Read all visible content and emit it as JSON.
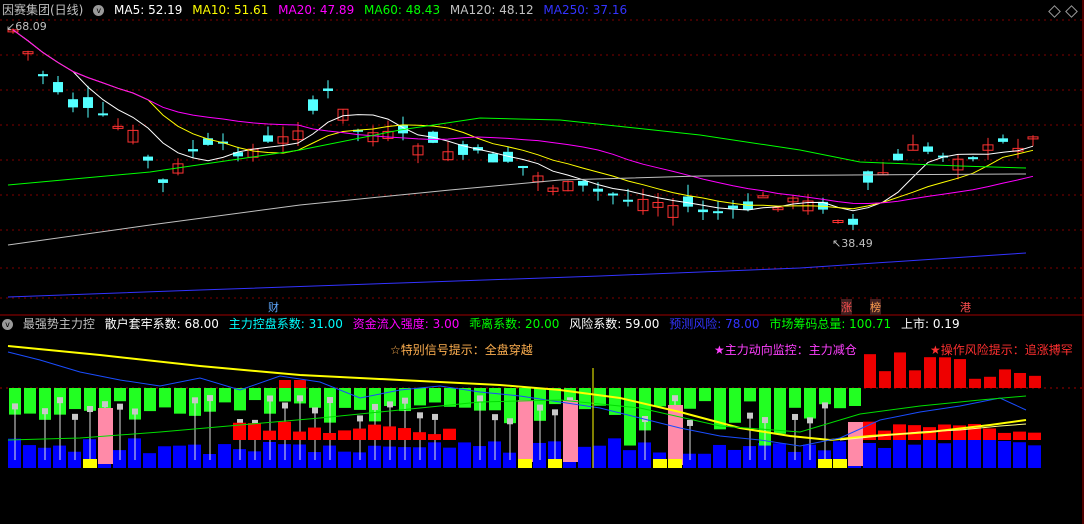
{
  "top_panel": {
    "title": "因赛集团(日线)",
    "ma": [
      {
        "label": "MA5: 52.19",
        "color": "#ffffff"
      },
      {
        "label": "MA10: 51.61",
        "color": "#ffff00"
      },
      {
        "label": "MA20: 47.89",
        "color": "#ff00ff"
      },
      {
        "label": "MA60: 48.43",
        "color": "#00ff00"
      },
      {
        "label": "MA120: 48.12",
        "color": "#c0c0c0"
      },
      {
        "label": "MA250: 37.16",
        "color": "#3333ff"
      }
    ],
    "high_label": "68.09",
    "low_label": "38.49",
    "markers": [
      {
        "text": "财",
        "color": "#5fa8ff"
      },
      {
        "text": "涨",
        "color": "#ff5050"
      },
      {
        "text": "榜",
        "color": "#ffa050"
      },
      {
        "text": "港",
        "color": "#ff5050"
      }
    ]
  },
  "bottom_panel": {
    "title": "最强势主力控",
    "params": [
      {
        "label": "散户套牢系数: 68.00",
        "color": "#ffffff"
      },
      {
        "label": "主力控盘系数: 31.00",
        "color": "#00ffff"
      },
      {
        "label": "资金流入强度: 3.00",
        "color": "#ff00ff"
      },
      {
        "label": "乖离系数: 20.00",
        "color": "#00ff00"
      },
      {
        "label": "风险系数: 59.00",
        "color": "#ffffff"
      },
      {
        "label": "预测风险: 78.00",
        "color": "#3333ff"
      },
      {
        "label": "市场筹码总量: 100.71",
        "color": "#00ff00"
      },
      {
        "label": "上市: 0.19",
        "color": "#ffffff"
      }
    ],
    "signals": [
      {
        "text": "☆特别信号提示：全盘穿越",
        "color": "#ffb050"
      },
      {
        "text": "★主力动向监控：主力减仓",
        "color": "#ff40ff"
      },
      {
        "text": "★操作风险提示：追涨搏罕",
        "color": "#ff3030"
      }
    ]
  },
  "colors": {
    "up": "#ff3232",
    "down": "#54ffff",
    "grid": "#800000",
    "ma5": "#ffffff",
    "ma10": "#ffff00",
    "ma20": "#ff00ff",
    "ma60": "#00ff00",
    "ma120": "#c0c0c0",
    "ma250": "#3333ff"
  },
  "icons": {
    "panel_toggle": "chevron-circle-icon",
    "window_control": "diamond-icon"
  }
}
